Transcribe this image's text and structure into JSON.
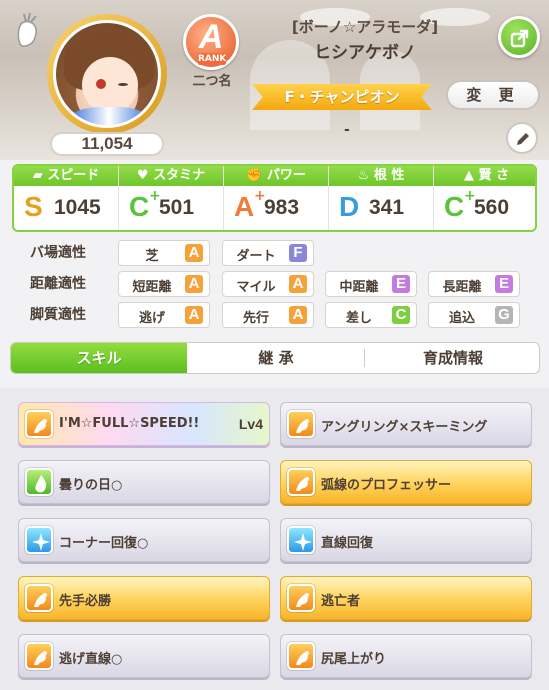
{
  "profile": {
    "fans": "11,054",
    "rank_letter": "A",
    "rank_word": "RANK",
    "title_label": "二つ名",
    "trainer_sub": "[ボーノ☆アラモーダ]",
    "trainer_name": "ヒシアケボノ",
    "champion": "F・チャンピオン",
    "change_label": "変 更",
    "comment": "-"
  },
  "stats": [
    {
      "label": "スピード",
      "icon": "shoe-icon",
      "grade": "S",
      "plus": "",
      "value": "1045",
      "color": "#e4a11b"
    },
    {
      "label": "スタミナ",
      "icon": "heart-icon",
      "grade": "C",
      "plus": "+",
      "value": "501",
      "color": "#5cc23a"
    },
    {
      "label": "パワー",
      "icon": "arm-icon",
      "grade": "A",
      "plus": "+",
      "value": "983",
      "color": "#f07a3a"
    },
    {
      "label": "根 性",
      "icon": "flame-icon",
      "grade": "D",
      "plus": "",
      "value": "341",
      "color": "#3b9be0"
    },
    {
      "label": "賢 さ",
      "icon": "cap-icon",
      "grade": "C",
      "plus": "+",
      "value": "560",
      "color": "#5cc23a"
    }
  ],
  "aptitude": {
    "track": {
      "label": "バ場適性",
      "items": [
        {
          "name": "芝",
          "grade": "A"
        },
        {
          "name": "ダート",
          "grade": "F"
        }
      ]
    },
    "distance": {
      "label": "距離適性",
      "items": [
        {
          "name": "短距離",
          "grade": "A"
        },
        {
          "name": "マイル",
          "grade": "A"
        },
        {
          "name": "中距離",
          "grade": "E"
        },
        {
          "name": "長距離",
          "grade": "E"
        }
      ]
    },
    "style": {
      "label": "脚質適性",
      "items": [
        {
          "name": "逃げ",
          "grade": "A"
        },
        {
          "name": "先行",
          "grade": "A"
        },
        {
          "name": "差し",
          "grade": "C"
        },
        {
          "name": "追込",
          "grade": "G"
        }
      ]
    }
  },
  "grade_colors": {
    "A": "#f5a23a",
    "C": "#7ccf3e",
    "E": "#c57ae0",
    "F": "#8a86d8",
    "G": "#b5b5b5"
  },
  "tabs": [
    "スキル",
    "継 承",
    "育成情報"
  ],
  "skills": [
    {
      "name": "I'M☆FULL☆SPEED!!",
      "level": "Lv4",
      "style": "rainbow",
      "icon": "orange"
    },
    {
      "name": "アングリング×スキーミング",
      "level": "",
      "style": "plain",
      "icon": "orange"
    },
    {
      "name": "曇りの日○",
      "level": "",
      "style": "plain",
      "icon": "green"
    },
    {
      "name": "弧線のプロフェッサー",
      "level": "",
      "style": "gold",
      "icon": "orange"
    },
    {
      "name": "コーナー回復○",
      "level": "",
      "style": "plain",
      "icon": "blue"
    },
    {
      "name": "直線回復",
      "level": "",
      "style": "plain",
      "icon": "blue"
    },
    {
      "name": "先手必勝",
      "level": "",
      "style": "gold",
      "icon": "orange"
    },
    {
      "name": "逃亡者",
      "level": "",
      "style": "gold",
      "icon": "orange"
    },
    {
      "name": "逃げ直線○",
      "level": "",
      "style": "plain",
      "icon": "orange"
    },
    {
      "name": "尻尾上がり",
      "level": "",
      "style": "plain",
      "icon": "orange"
    }
  ]
}
